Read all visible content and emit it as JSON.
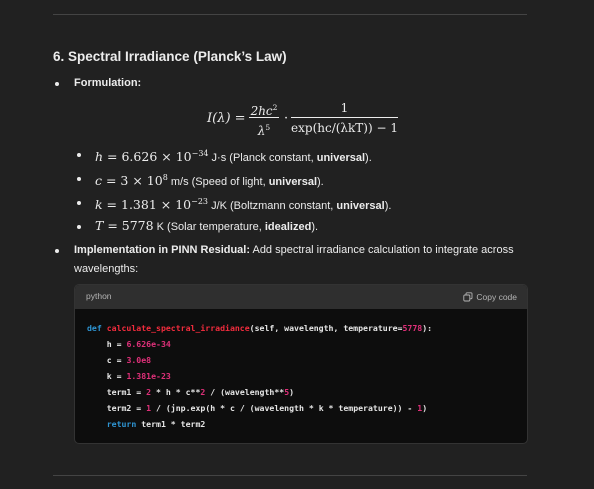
{
  "section": {
    "heading": "6. Spectral Irradiance (Planck’s Law)"
  },
  "formulation": {
    "label": "Formulation:",
    "formula": {
      "lhs": "I(λ) =",
      "frac1_num": "2hc",
      "frac1_num_exp": "2",
      "frac1_den": "λ",
      "frac1_den_exp": "5",
      "cdot": "·",
      "frac2_num": "1",
      "frac2_den": "exp(hc/(λkT)) − 1"
    }
  },
  "constants": [
    {
      "sym": "h",
      "eq": " = 6.626 × 10",
      "exp": "−34",
      "unit": " J·s (Planck constant, ",
      "bold": "universal",
      "tail": ")."
    },
    {
      "sym": "c",
      "eq": " = 3 × 10",
      "exp": "8",
      "unit": " m/s (Speed of light, ",
      "bold": "universal",
      "tail": ")."
    },
    {
      "sym": "k",
      "eq": " = 1.381 × 10",
      "exp": "−23",
      "unit": " J/K (Boltzmann constant, ",
      "bold": "universal",
      "tail": ")."
    },
    {
      "sym": "T",
      "eq": " = 5778",
      "exp": "",
      "unit": " K (Solar temperature, ",
      "bold": "idealized",
      "tail": ")."
    }
  ],
  "implementation": {
    "label": "Implementation in PINN Residual:",
    "text1": " Add spectral irradiance calculation to integrate across",
    "text2": "wavelengths:"
  },
  "code": {
    "language": "python",
    "copy_label": "Copy code",
    "l1_def": "def ",
    "l1_fn": "calculate_spectral_irradiance",
    "l1_args": "(self, wavelength, temperature=",
    "l1_num": "5778",
    "l1_end": "):",
    "l2_a": "    h = ",
    "l2_num": "6.626e-34",
    "l3_a": "    c = ",
    "l3_num": "3.0e8",
    "l4_a": "    k = ",
    "l4_num": "1.381e-23",
    "l5_a": "    term1 = ",
    "l5_n1": "2",
    "l5_b": " * h * c**",
    "l5_n2": "2",
    "l5_c": " / (wavelength**",
    "l5_n3": "5",
    "l5_d": ")",
    "l6_a": "    term2 = ",
    "l6_n1": "1",
    "l6_b": " / (jnp.exp(h * c / (wavelength * k * temperature)) - ",
    "l6_n2": "1",
    "l6_c": ")",
    "l7_kw": "    return",
    "l7_a": " term1 * term2"
  },
  "colors": {
    "background": "#212121",
    "code_background": "#0d0d0d",
    "code_header": "#2f2f2f",
    "keyword": "#2e95d3",
    "function_name": "#f22c3d",
    "number": "#df3079"
  }
}
